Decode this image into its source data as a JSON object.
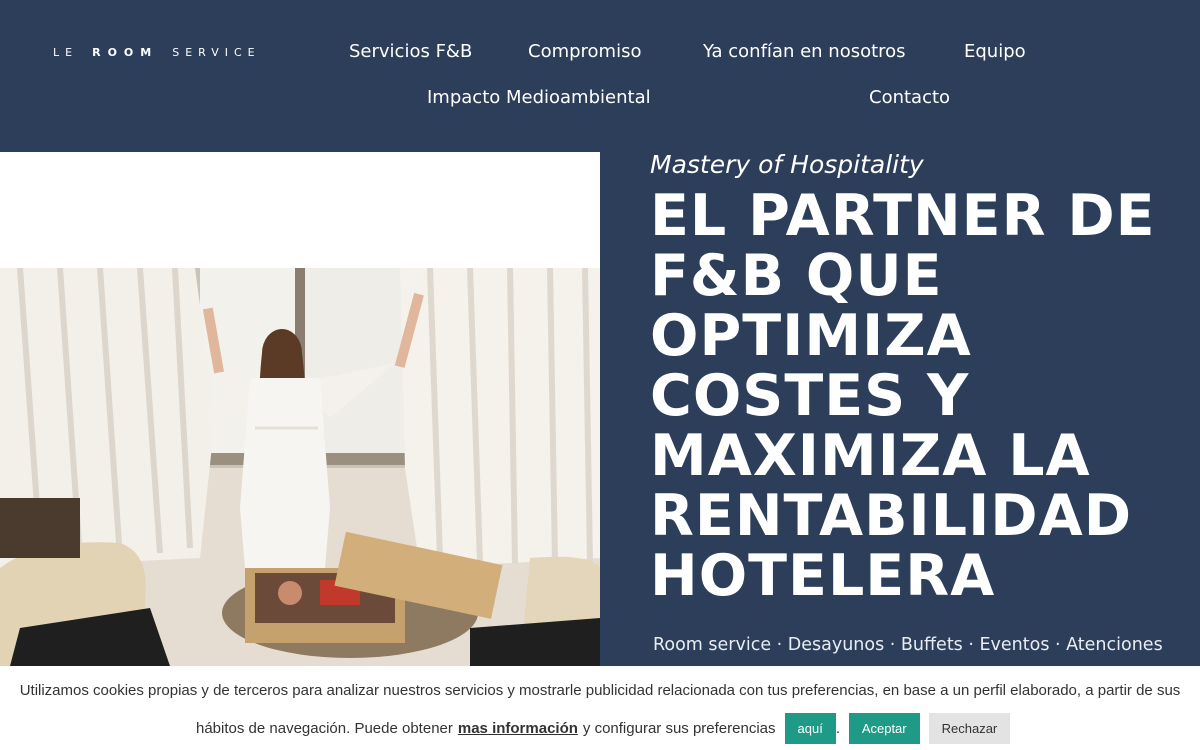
{
  "logo": {
    "part1": "LE",
    "part2": "ROOM",
    "part3": "SERVICE"
  },
  "nav": {
    "items": [
      {
        "label": "Servicios F&B"
      },
      {
        "label": "Compromiso"
      },
      {
        "label": "Ya confían en nosotros"
      },
      {
        "label": "Equipo"
      },
      {
        "label": "Impacto Medioambiental"
      },
      {
        "label": "Contacto"
      }
    ]
  },
  "hero": {
    "kicker": "Mastery of Hospitality",
    "headline": [
      "EL PARTNER DE",
      "F&B QUE",
      "OPTIMIZA",
      "COSTES Y",
      "MAXIMIZA LA",
      "RENTABILIDAD",
      "HOTELERA"
    ],
    "services": "Room service · Desayunos · Buffets · Eventos · Atenciones"
  },
  "cookie": {
    "text1": "Utilizamos cookies propias y de terceros para analizar nuestros servicios y mostrarle publicidad relacionada con tus preferencias, en base a un perfil elaborado, a partir de sus",
    "text2a": "hábitos de navegación. Puede obtener",
    "more_link": "mas información",
    "text2b": "y configurar sus preferencias",
    "aqui": "aquí",
    "period": ".",
    "accept": "Aceptar",
    "reject": "Rechazar"
  },
  "colors": {
    "navy": "#2c3e5a",
    "accent": "#1f9a86"
  }
}
